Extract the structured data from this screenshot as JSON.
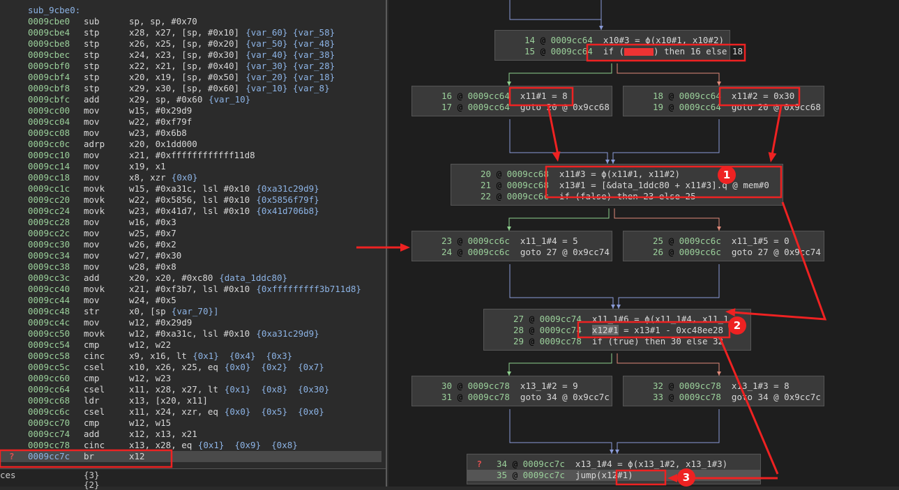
{
  "function_label": "sub_9cbe0:",
  "disassembly": [
    {
      "addr": "0009cbe0",
      "mnem": "sub",
      "ops": "sp, sp, #0x70",
      "ann": ""
    },
    {
      "addr": "0009cbe4",
      "mnem": "stp",
      "ops": "x28, x27, [sp, #0x10]",
      "ann": "{var_60} {var_58}"
    },
    {
      "addr": "0009cbe8",
      "mnem": "stp",
      "ops": "x26, x25, [sp, #0x20]",
      "ann": "{var_50} {var_48}"
    },
    {
      "addr": "0009cbec",
      "mnem": "stp",
      "ops": "x24, x23, [sp, #0x30]",
      "ann": "{var_40} {var_38}"
    },
    {
      "addr": "0009cbf0",
      "mnem": "stp",
      "ops": "x22, x21, [sp, #0x40]",
      "ann": "{var_30} {var_28}"
    },
    {
      "addr": "0009cbf4",
      "mnem": "stp",
      "ops": "x20, x19, [sp, #0x50]",
      "ann": "{var_20} {var_18}"
    },
    {
      "addr": "0009cbf8",
      "mnem": "stp",
      "ops": "x29, x30, [sp, #0x60]",
      "ann": "{var_10} {var_8}"
    },
    {
      "addr": "0009cbfc",
      "mnem": "add",
      "ops": "x29, sp, #0x60",
      "ann": "{var_10}"
    },
    {
      "addr": "0009cc00",
      "mnem": "mov",
      "ops": "w15, #0x29d9",
      "ann": ""
    },
    {
      "addr": "0009cc04",
      "mnem": "mov",
      "ops": "w22, #0xf79f",
      "ann": ""
    },
    {
      "addr": "0009cc08",
      "mnem": "mov",
      "ops": "w23, #0x6b8",
      "ann": ""
    },
    {
      "addr": "0009cc0c",
      "mnem": "adrp",
      "ops": "x20, 0x1dd000",
      "ann": ""
    },
    {
      "addr": "0009cc10",
      "mnem": "mov",
      "ops": "x21, #0xffffffffffff11d8",
      "ann": ""
    },
    {
      "addr": "0009cc14",
      "mnem": "mov",
      "ops": "x19, x1",
      "ann": ""
    },
    {
      "addr": "0009cc18",
      "mnem": "mov",
      "ops": "x8, xzr",
      "ann": "{0x0}"
    },
    {
      "addr": "0009cc1c",
      "mnem": "movk",
      "ops": "w15, #0xa31c, lsl #0x10",
      "ann": "{0xa31c29d9}"
    },
    {
      "addr": "0009cc20",
      "mnem": "movk",
      "ops": "w22, #0x5856, lsl #0x10",
      "ann": "{0x5856f79f}"
    },
    {
      "addr": "0009cc24",
      "mnem": "movk",
      "ops": "w23, #0x41d7, lsl #0x10",
      "ann": "{0x41d706b8}"
    },
    {
      "addr": "0009cc28",
      "mnem": "mov",
      "ops": "w16, #0x3",
      "ann": ""
    },
    {
      "addr": "0009cc2c",
      "mnem": "mov",
      "ops": "w25, #0x7",
      "ann": ""
    },
    {
      "addr": "0009cc30",
      "mnem": "mov",
      "ops": "w26, #0x2",
      "ann": ""
    },
    {
      "addr": "0009cc34",
      "mnem": "mov",
      "ops": "w27, #0x30",
      "ann": ""
    },
    {
      "addr": "0009cc38",
      "mnem": "mov",
      "ops": "w28, #0x8",
      "ann": ""
    },
    {
      "addr": "0009cc3c",
      "mnem": "add",
      "ops": "x20, x20, #0xc80",
      "ann": "{data_1ddc80}"
    },
    {
      "addr": "0009cc40",
      "mnem": "movk",
      "ops": "x21, #0xf3b7, lsl #0x10",
      "ann": "{0xfffffffff3b711d8}"
    },
    {
      "addr": "0009cc44",
      "mnem": "mov",
      "ops": "w24, #0x5",
      "ann": ""
    },
    {
      "addr": "0009cc48",
      "mnem": "str",
      "ops": "x0, [sp",
      "ann": "{var_70}]"
    },
    {
      "addr": "0009cc4c",
      "mnem": "mov",
      "ops": "w12, #0x29d9",
      "ann": ""
    },
    {
      "addr": "0009cc50",
      "mnem": "movk",
      "ops": "w12, #0xa31c, lsl #0x10",
      "ann": "{0xa31c29d9}"
    },
    {
      "addr": "0009cc54",
      "mnem": "cmp",
      "ops": "w12, w22",
      "ann": ""
    },
    {
      "addr": "0009cc58",
      "mnem": "cinc",
      "ops": "x9, x16, lt",
      "ann": "{0x1}  {0x4}  {0x3}"
    },
    {
      "addr": "0009cc5c",
      "mnem": "csel",
      "ops": "x10, x26, x25, eq",
      "ann": "{0x0}  {0x2}  {0x7}"
    },
    {
      "addr": "0009cc60",
      "mnem": "cmp",
      "ops": "w12, w23",
      "ann": ""
    },
    {
      "addr": "0009cc64",
      "mnem": "csel",
      "ops": "x11, x28, x27, lt",
      "ann": "{0x1}  {0x8}  {0x30}"
    },
    {
      "addr": "0009cc68",
      "mnem": "ldr",
      "ops": "x13, [x20, x11]",
      "ann": ""
    },
    {
      "addr": "0009cc6c",
      "mnem": "csel",
      "ops": "x11, x24, xzr, eq",
      "ann": "{0x0}  {0x5}  {0x0}"
    },
    {
      "addr": "0009cc70",
      "mnem": "cmp",
      "ops": "w12, w15",
      "ann": ""
    },
    {
      "addr": "0009cc74",
      "mnem": "add",
      "ops": "x12, x13, x21",
      "ann": ""
    },
    {
      "addr": "0009cc78",
      "mnem": "cinc",
      "ops": "x13, x28, eq",
      "ann": "{0x1}  {0x9}  {0x8}"
    },
    {
      "addr": "0009cc7c",
      "mnem": "br",
      "ops": "x12",
      "ann": "",
      "current": true
    }
  ],
  "bottom_panel": [
    {
      "label": "ces",
      "count": "{3}"
    },
    {
      "label": "",
      "count": "{2}"
    }
  ],
  "icons": {
    "breakpoint": "question-mark-warning-icon",
    "warn_glyph": "?"
  },
  "graph_nodes": [
    {
      "id": "n14",
      "lines": [
        {
          "idx": "14",
          "addr": "0009cc64",
          "code": "x10#3 = ϕ(x10#1, x10#2)"
        },
        {
          "idx": "15",
          "addr": "0009cc64",
          "code": "if (",
          "redact": true,
          "code2": ") then 16 else 18"
        }
      ]
    },
    {
      "id": "n16",
      "lines": [
        {
          "idx": "16",
          "addr": "0009cc64",
          "code": "x11#1 = 8"
        },
        {
          "idx": "17",
          "addr": "0009cc64",
          "code": "goto 20 @ 0x9cc68"
        }
      ]
    },
    {
      "id": "n18",
      "lines": [
        {
          "idx": "18",
          "addr": "0009cc64",
          "code": "x11#2 = 0x30"
        },
        {
          "idx": "19",
          "addr": "0009cc64",
          "code": "goto 20 @ 0x9cc68"
        }
      ]
    },
    {
      "id": "n20",
      "lines": [
        {
          "idx": "20",
          "addr": "0009cc68",
          "code": "x11#3 = ϕ(x11#1, x11#2)"
        },
        {
          "idx": "21",
          "addr": "0009cc68",
          "code": "x13#1 = [&data_1ddc80 + x11#3].q @ mem#0"
        },
        {
          "idx": "22",
          "addr": "0009cc6c",
          "code": "if (false) then 23 else 25"
        }
      ]
    },
    {
      "id": "n23",
      "lines": [
        {
          "idx": "23",
          "addr": "0009cc6c",
          "code": "x11_1#4 = 5"
        },
        {
          "idx": "24",
          "addr": "0009cc6c",
          "code": "goto 27 @ 0x9cc74"
        }
      ]
    },
    {
      "id": "n25",
      "lines": [
        {
          "idx": "25",
          "addr": "0009cc6c",
          "code": "x11_1#5 = 0"
        },
        {
          "idx": "26",
          "addr": "0009cc6c",
          "code": "goto 27 @ 0x9cc74"
        }
      ]
    },
    {
      "id": "n27",
      "lines": [
        {
          "idx": "27",
          "addr": "0009cc74",
          "code": "x11_1#6 = ϕ(x11_1#4, x11_1"
        },
        {
          "idx": "28",
          "addr": "0009cc74",
          "code": "x12#1 = x13#1 - 0xc48ee28",
          "hl_prefix": true
        },
        {
          "idx": "29",
          "addr": "0009cc78",
          "code": "if (true) then 30 else 32"
        }
      ]
    },
    {
      "id": "n30",
      "lines": [
        {
          "idx": "30",
          "addr": "0009cc78",
          "code": "x13_1#2 = 9"
        },
        {
          "idx": "31",
          "addr": "0009cc78",
          "code": "goto 34 @ 0x9cc7c"
        }
      ]
    },
    {
      "id": "n32",
      "lines": [
        {
          "idx": "32",
          "addr": "0009cc78",
          "code": "x13_1#3 = 8"
        },
        {
          "idx": "33",
          "addr": "0009cc78",
          "code": "goto 34 @ 0x9cc7c"
        }
      ]
    },
    {
      "id": "n34",
      "lines": [
        {
          "idx": "34",
          "addr": "0009cc7c",
          "code": "x13_1#4 = ϕ(x13_1#2, x13_1#3)",
          "warn": true
        },
        {
          "idx": "35",
          "addr": "0009cc7c",
          "code": "jump(x12#1)",
          "current": true
        }
      ]
    }
  ],
  "annotations": {
    "badge_1": "1",
    "badge_2": "2",
    "badge_3": "3",
    "arrow_color": "#ee2222",
    "badge_color": "#ee2222"
  },
  "edge_colors": {
    "true": "#8fd18f",
    "false": "#e08a7a",
    "unconditional": "#8a9bd8"
  }
}
